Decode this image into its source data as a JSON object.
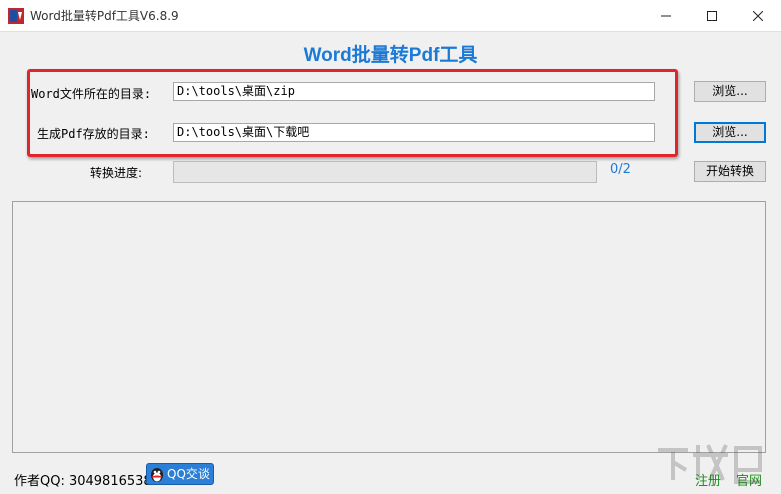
{
  "window": {
    "title": "Word批量转Pdf工具V6.8.9",
    "minimize_icon": "minimize-icon",
    "maximize_icon": "maximize-icon",
    "close_icon": "close-icon"
  },
  "heading": "Word批量转Pdf工具",
  "source_dir": {
    "label": "Word文件所在的目录:",
    "value": "D:\\tools\\桌面\\zip",
    "browse_label": "浏览..."
  },
  "output_dir": {
    "label": "生成Pdf存放的目录:",
    "value": "D:\\tools\\桌面\\下载吧",
    "browse_label": "浏览..."
  },
  "progress": {
    "label": "转换进度:",
    "text": "0/2",
    "fraction": 0,
    "start_label": "开始转换"
  },
  "footer": {
    "author": "作者QQ: 3049816538",
    "qq_button": "QQ交谈",
    "register": "注册",
    "official_site": "官网"
  },
  "colors": {
    "accent": "#1c7ad7",
    "highlight_frame": "#e0262b",
    "link": "#1f8f1f"
  }
}
